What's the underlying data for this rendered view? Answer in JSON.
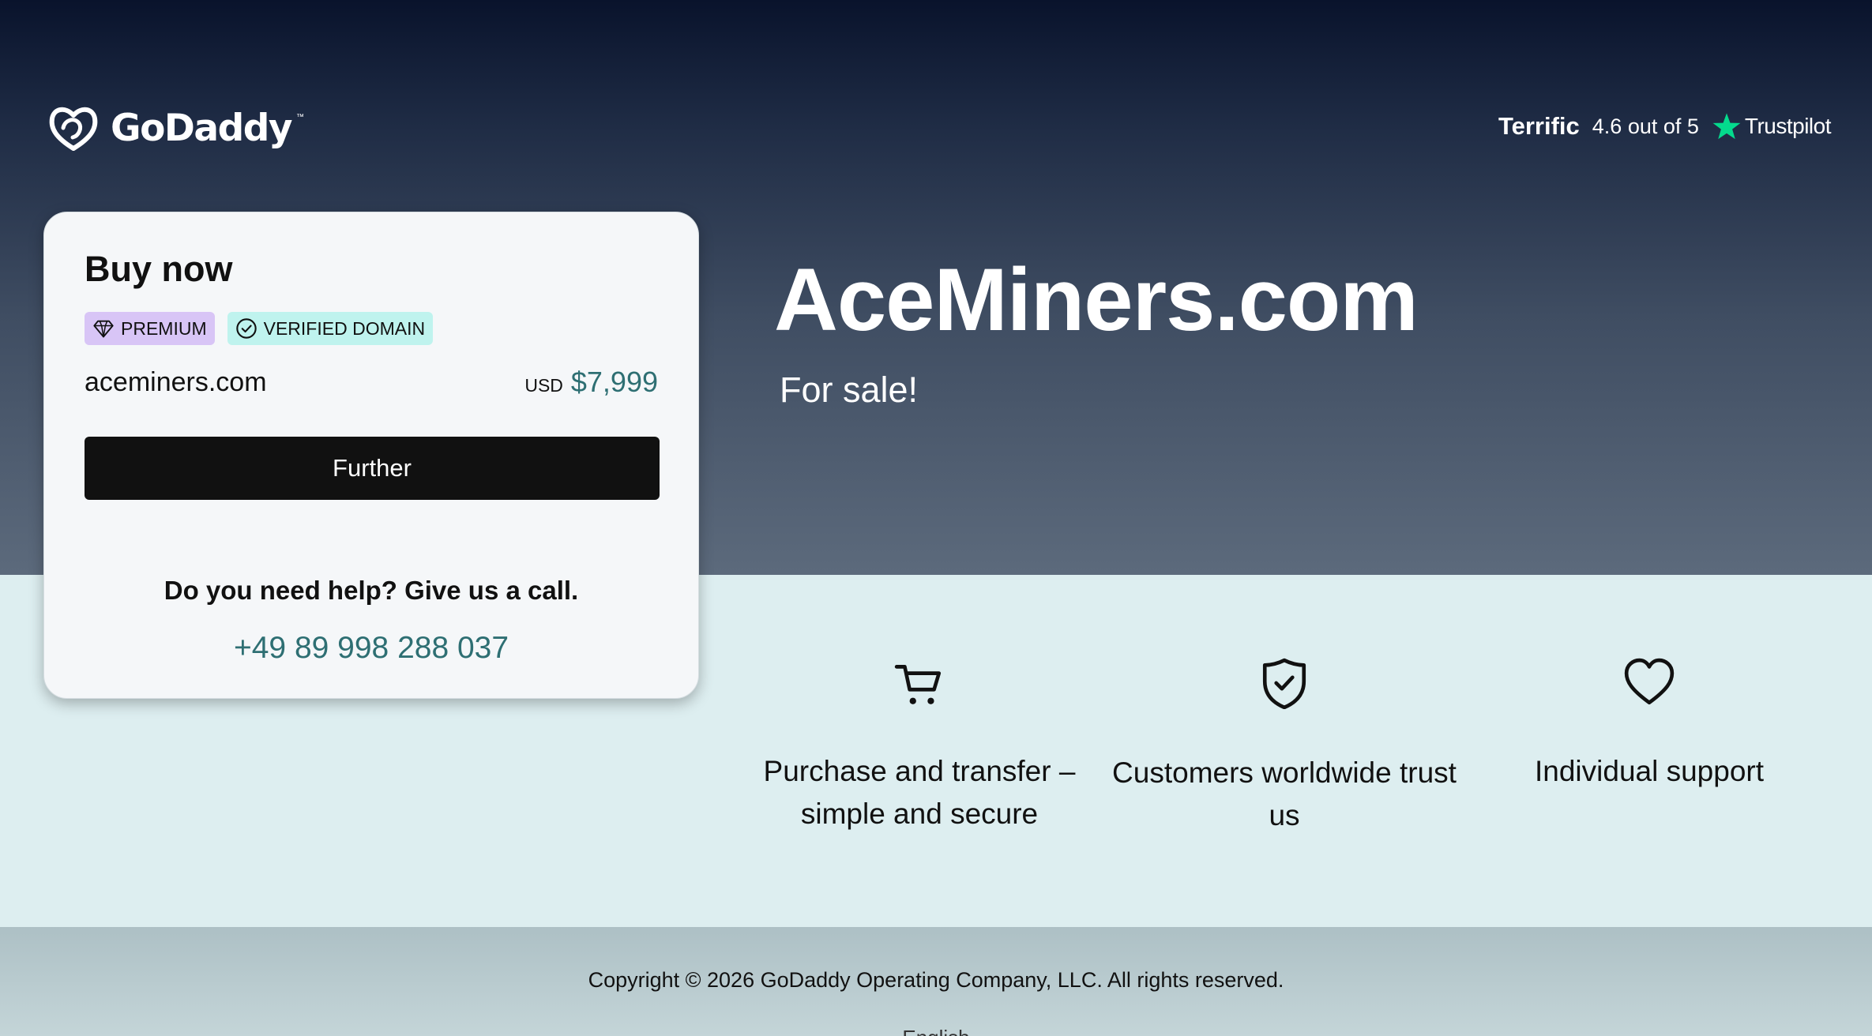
{
  "brand": {
    "name": "GoDaddy",
    "logo_icon": "godaddy-heart-icon"
  },
  "trustpilot": {
    "rating_word": "Terrific",
    "score_text": "4.6 out of 5",
    "brand": "Trustpilot",
    "star_color": "#04da8d"
  },
  "hero": {
    "domain_title": "AceMiners.com",
    "subtitle": "For sale!"
  },
  "buy_card": {
    "title": "Buy now",
    "badges": [
      {
        "label": "PREMIUM",
        "icon": "diamond-icon",
        "color": "#d8c5f6"
      },
      {
        "label": "VERIFIED DOMAIN",
        "icon": "check-circle-icon",
        "color": "#bff3ee"
      }
    ],
    "domain": "aceminers.com",
    "currency": "USD",
    "price": "$7,999",
    "button_label": "Further",
    "help_text": "Do you need help? Give us a call.",
    "phone": "+49 89 998 288 037"
  },
  "features": [
    {
      "icon": "cart-icon",
      "text": "Purchase and transfer – simple and secure"
    },
    {
      "icon": "shield-check-icon",
      "text": "Customers worldwide trust us"
    },
    {
      "icon": "heart-icon",
      "text": "Individual support"
    }
  ],
  "footer": {
    "copyright": "Copyright © 2026 GoDaddy Operating Company, LLC. All rights reserved.",
    "language": "English"
  },
  "colors": {
    "accent_teal": "#2e6f73",
    "button_bg": "#111111",
    "band_bg": "#ddeef0"
  }
}
